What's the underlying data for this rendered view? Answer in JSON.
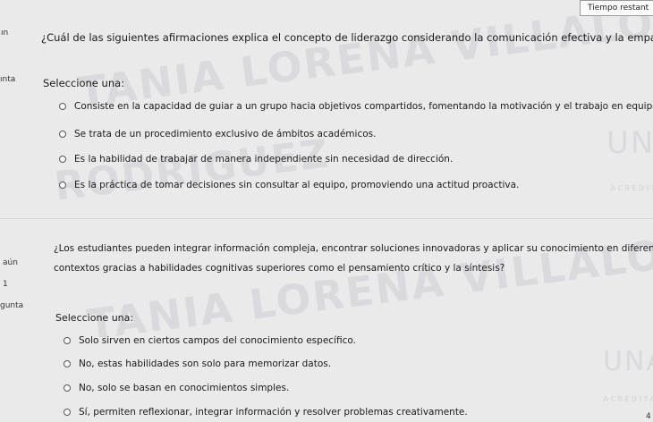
{
  "sidebar": {
    "q1_label_fragment": "ın",
    "q1_sub_fragment": "ınta",
    "q2_status_fragment": "aún",
    "q2_number_fragment": "1",
    "q2_label_fragment": "gunta"
  },
  "timer": {
    "label": "Tiempo restant"
  },
  "question1": {
    "text": "¿Cuál de las siguientes afirmaciones explica el concepto de liderazgo considerando la comunicación efectiva y la empatía?",
    "select_label": "Seleccione una:",
    "options": [
      "Consiste en la capacidad de guiar a un grupo hacia objetivos compartidos, fomentando la motivación y el trabajo en equipo.",
      "Se trata de un procedimiento exclusivo de ámbitos académicos.",
      "Es la habilidad de trabajar de manera independiente sin necesidad de dirección.",
      "Es la práctica de tomar decisiones sin consultar al equipo, promoviendo una actitud proactiva."
    ]
  },
  "question2": {
    "text_line1": "¿Los estudiantes pueden integrar información compleja, encontrar soluciones innovadoras y aplicar su conocimiento en diferentes",
    "text_line2": "contextos gracias a habilidades cognitivas superiores como el pensamiento crítico y la síntesis?",
    "select_label": "Seleccione una:",
    "options": [
      "Solo sirven en ciertos campos del conocimiento específico.",
      "No, estas habilidades son solo para memorizar datos.",
      "No, solo se basan en conocimientos simples.",
      "Sí, permiten reflexionar, integrar información y resolver problemas creativamente."
    ]
  },
  "watermarks": {
    "wm1": "TANIA LORENA VILLALOBOS",
    "wm2": "RODRIGUEZ",
    "wm3": "TANIA LORENA VILLALOBOS",
    "logo1": "UN",
    "logo1_sub": "ACREDITA",
    "logo2": "UNA",
    "logo2_sub": "ACREDITADA"
  },
  "page_number_fragment": "4"
}
